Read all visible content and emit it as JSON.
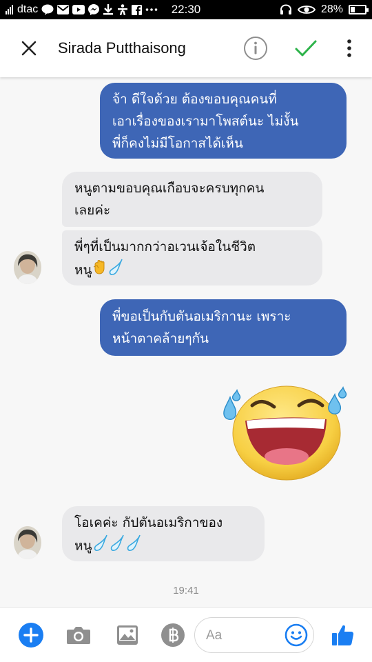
{
  "status_bar": {
    "carrier": "dtac",
    "time": "22:30",
    "battery": "28%",
    "battery_level": 0.28,
    "icons": [
      "signal-icon",
      "line-app-icon",
      "mail-icon",
      "youtube-icon",
      "messenger-icon",
      "download-icon",
      "accessibility-icon",
      "facebook-icon",
      "more-notifications-icon",
      "headset-icon",
      "eye-icon",
      "battery-icon"
    ]
  },
  "header": {
    "contact_name": "Sirada Putthaisong",
    "icons": [
      "close-icon",
      "info-icon",
      "checkmark-icon",
      "more-vertical-icon"
    ],
    "accent_color": "#2db34a"
  },
  "messages": [
    {
      "direction": "outgoing",
      "lines": [
        "จ้า ดีใจด้วย ต้องขอบคุณคนที่",
        "เอาเรื่องของเรามาโพสต์นะ ไม่งั้น",
        "พี่ก็คงไม่มีโอกาสได้เห็น"
      ]
    },
    {
      "direction": "incoming",
      "lines": [
        "หนูตามขอบคุณเกือบจะครบทุกคน",
        "เลยค่ะ"
      ]
    },
    {
      "direction": "incoming",
      "lines": [
        "พี่ๆที่เป็นมากกว่าอเวนเจ้อในชีวิต",
        "หนู"
      ],
      "emojis": [
        "raised-fist-emoji",
        "sweat-droplet-emoji"
      ]
    },
    {
      "direction": "outgoing",
      "lines": [
        "พี่ขอเป็นกับตันอเมริกานะ เพราะ",
        "หน้าตาคล้ายๆกัน"
      ]
    },
    {
      "direction": "outgoing",
      "sticker": "laughing-tears-sticker"
    },
    {
      "direction": "incoming",
      "lines": [
        "โอเคค่ะ กัปตันอเมริกาของ",
        "หนู"
      ],
      "emojis": [
        "sweat-droplet-emoji",
        "sweat-droplet-emoji",
        "sweat-droplet-emoji"
      ]
    }
  ],
  "timestamp": "19:41",
  "composer": {
    "placeholder": "Aa",
    "icons": [
      "add-icon",
      "camera-icon",
      "image-icon",
      "baht-payment-icon",
      "emoji-icon",
      "thumbs-up-icon"
    ]
  },
  "colors": {
    "outgoing_bubble": "#3e66b6",
    "incoming_bubble": "#e9e9eb",
    "messenger_blue": "#1a7ef2"
  }
}
